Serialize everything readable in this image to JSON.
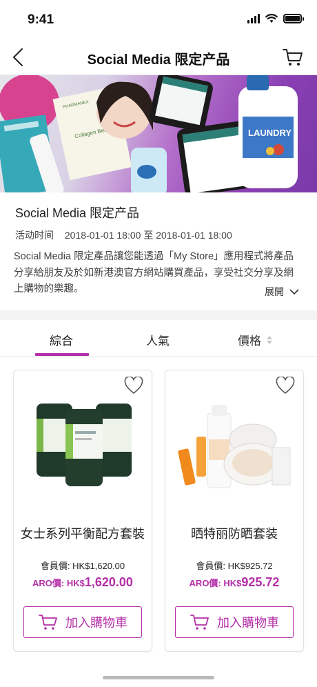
{
  "status_bar": {
    "time": "9:41"
  },
  "nav": {
    "title": "Social Media 限定产品"
  },
  "info": {
    "title": "Social Media 限定产品",
    "time_label": "活动时间",
    "time_range": "2018-01-01 18:00 至 2018-01-01 18:00",
    "description": "Social Media 限定產品讓您能透過「My Store」應用程式將產品分享給朋友及於如新港澳官方網站購買產品，享受社交分享及網上購物的樂趣。",
    "expand_label": "展開"
  },
  "tabs": [
    {
      "label": "綜合",
      "active": true
    },
    {
      "label": "人氣",
      "active": false
    },
    {
      "label": "價格",
      "active": false
    }
  ],
  "products": [
    {
      "name": "女士系列平衡配方套裝",
      "member_price_label": "會員價: ",
      "member_price": "HK$1,620.00",
      "aro_label": "ARO價: HK$",
      "aro_value": "1,620.00",
      "add_to_cart_label": "加入購物車"
    },
    {
      "name": "晒特丽防晒套装",
      "member_price_label": "會員價: ",
      "member_price": "HK$925.72",
      "aro_label": "ARO價: HK$",
      "aro_value": "925.72",
      "add_to_cart_label": "加入購物車"
    }
  ],
  "banner": {
    "laundry_text": "LAUNDRY",
    "brand_text": "PHARMANEX"
  },
  "colors": {
    "accent": "#b42ea8",
    "banner_purple": "#8a3fb3"
  },
  "icons": [
    "back-arrow-icon",
    "cart-icon",
    "heart-icon",
    "sort-arrows-icon",
    "chevron-down-icon"
  ]
}
